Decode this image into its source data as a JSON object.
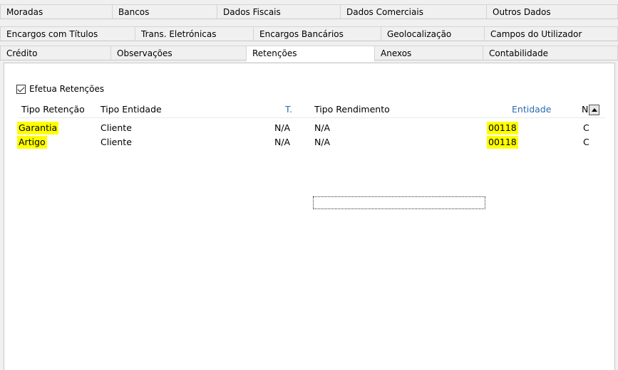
{
  "tabs": {
    "row1": [
      {
        "label": "Moradas"
      },
      {
        "label": "Bancos"
      },
      {
        "label": "Dados Fiscais"
      },
      {
        "label": "Dados Comerciais"
      },
      {
        "label": "Outros Dados"
      }
    ],
    "row2": [
      {
        "label": "Encargos com Títulos"
      },
      {
        "label": "Trans. Eletrónicas"
      },
      {
        "label": "Encargos Bancários"
      },
      {
        "label": "Geolocalização"
      },
      {
        "label": "Campos do Utilizador"
      }
    ],
    "row3": [
      {
        "label": "Crédito"
      },
      {
        "label": "Observações"
      },
      {
        "label": "Retenções"
      },
      {
        "label": "Anexos"
      },
      {
        "label": "Contabilidade"
      }
    ]
  },
  "checkbox": {
    "label": "Efetua Retenções",
    "checked": true
  },
  "grid": {
    "headers": {
      "tipo_retencao": "Tipo Retenção",
      "tipo_entidade": "Tipo Entidade",
      "t": "T.",
      "tipo_rendimento": "Tipo Rendimento",
      "entidade": "Entidade",
      "more": "N"
    },
    "rows": [
      {
        "tipo_retencao": "Garantia",
        "tipo_entidade": "Cliente",
        "t": "N/A",
        "tipo_rendimento": "N/A",
        "entidade": "00118",
        "more": "C"
      },
      {
        "tipo_retencao": "Artigo",
        "tipo_entidade": "Cliente",
        "t": "N/A",
        "tipo_rendimento": "N/A",
        "entidade": "00118",
        "more": "C"
      }
    ]
  },
  "colors": {
    "highlight": "#ffff00",
    "header_blue": "#2e6ab3"
  }
}
